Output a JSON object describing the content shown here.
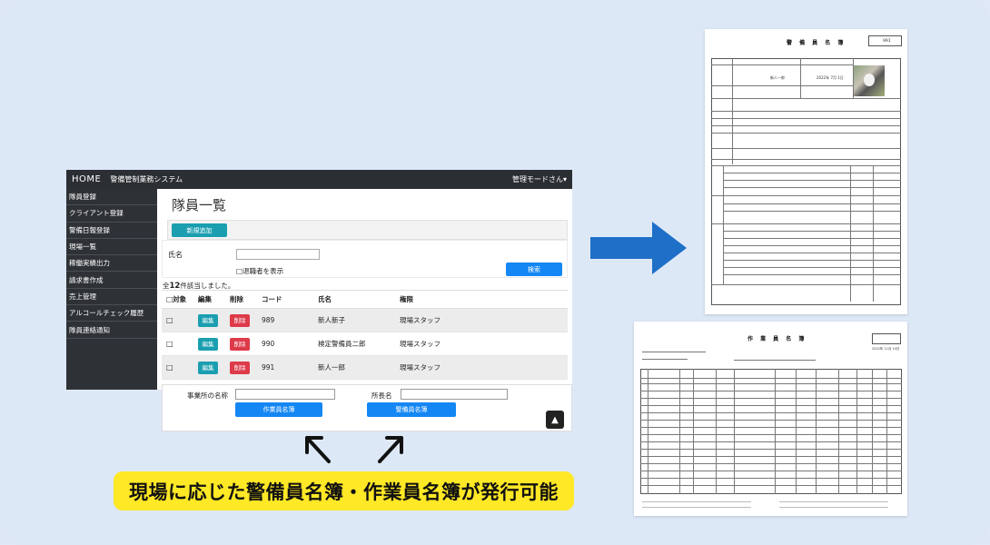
{
  "app": {
    "home": "HOME",
    "system_name": "警備管制業務システム",
    "user_mode": "管理モードさん▾",
    "sidebar": [
      "隊員登録",
      "クライアント登録",
      "警備日報登録",
      "現場一覧",
      "稼働実績出力",
      "請求書作成",
      "売上管理",
      "アルコールチェック履歴",
      "隊員連絡通知"
    ],
    "page_title": "隊員一覧",
    "new_button": "新規追加",
    "filter": {
      "name_label": "氏名",
      "retired_checkbox": "□退職者を表示",
      "search_button": "検索"
    },
    "count_prefix": "全",
    "count_number": "12",
    "count_suffix": "件該当しました。",
    "table": {
      "headers": [
        "□対象",
        "編集",
        "削除",
        "コード",
        "氏名",
        "権限"
      ],
      "edit_label": "編集",
      "delete_label": "削除",
      "rows": [
        {
          "check": "□",
          "code": "989",
          "name": "新人新子",
          "role": "現場スタッフ"
        },
        {
          "check": "□",
          "code": "990",
          "name": "検定警備員二郎",
          "role": "現場スタッフ"
        },
        {
          "check": "□",
          "code": "991",
          "name": "新人一郎",
          "role": "現場スタッフ"
        }
      ]
    },
    "bottom": {
      "office_label": "事業所の名称",
      "chief_label": "所長名",
      "worker_button": "作業員名簿",
      "guard_button": "警備員名簿"
    },
    "scroll_top_icon": "chevron-up-icon"
  },
  "caption": "現場に応じた警備員名簿・作業員名簿が発行可能",
  "doc1": {
    "title": "警 備 員 名 簿",
    "number": "991",
    "person_name": "新人一郎",
    "date": "2022年 7月 1日"
  },
  "doc2": {
    "title": "作 業 員 名 簿",
    "date": "2022年 11月 10日"
  },
  "colors": {
    "background": "#dde8f7",
    "caption_bg": "#ffe825",
    "teal": "#1b9fb0",
    "red": "#dd3a4a",
    "blue": "#1487f4",
    "arrow_blue": "#1e6fc8"
  }
}
